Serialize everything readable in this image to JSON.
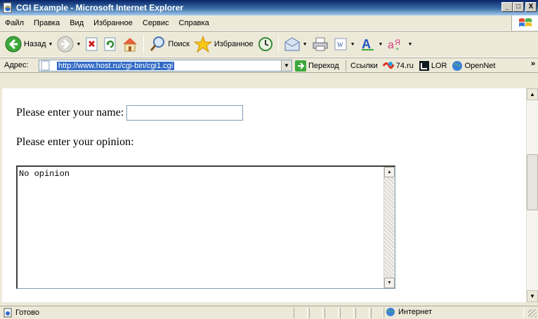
{
  "window": {
    "title": "CGI Example - Microsoft Internet Explorer",
    "minimize": "_",
    "maximize": "□",
    "close": "X"
  },
  "menu": {
    "items": [
      {
        "label": "Файл"
      },
      {
        "label": "Правка"
      },
      {
        "label": "Вид"
      },
      {
        "label": "Избранное"
      },
      {
        "label": "Сервис"
      },
      {
        "label": "Справка"
      }
    ]
  },
  "toolbar": {
    "back": "Назад",
    "search": "Поиск",
    "favorites": "Избранное",
    "icons": [
      "back-arrow-icon",
      "forward-arrow-icon",
      "stop-icon",
      "refresh-icon",
      "home-icon",
      "search-icon",
      "favorites-star-icon",
      "history-icon",
      "mail-icon",
      "print-icon",
      "edit-icon",
      "font-size-icon",
      "translate-icon"
    ]
  },
  "address": {
    "label": "Адрес:",
    "url": "http://www.host.ru/cgi-bin/cgi1.cgi",
    "go": "Переход",
    "links_label": "Ссылки",
    "links": [
      {
        "label": "74.ru"
      },
      {
        "label": "LOR"
      },
      {
        "label": "OpenNet"
      }
    ],
    "more": "»"
  },
  "page": {
    "name_prompt": "Please enter your name:",
    "name_value": "",
    "opinion_prompt": "Please enter your opinion:",
    "opinion_value": "No opinion"
  },
  "status": {
    "text": "Готово",
    "zone": "Интернет"
  }
}
